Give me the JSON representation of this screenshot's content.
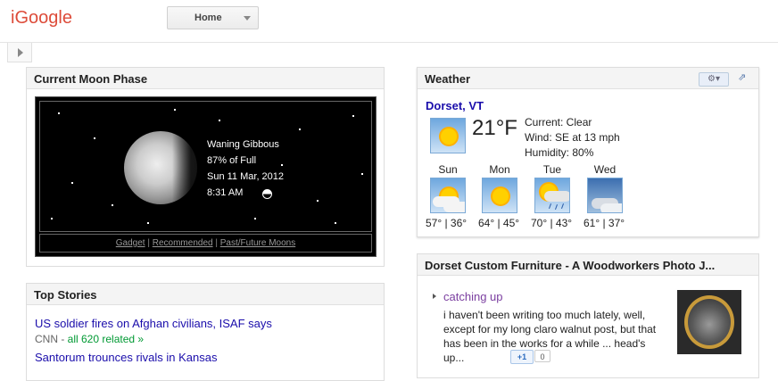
{
  "header": {
    "logo_text": "iGoogle",
    "tab_label": "Home"
  },
  "moon": {
    "title": "Current Moon Phase",
    "phase_name": "Waning Gibbous",
    "percent_full": "87% of Full",
    "date": "Sun 11 Mar, 2012",
    "time": "8:31 AM",
    "links": [
      "Gadget",
      "Recommended",
      "Past/Future Moons"
    ],
    "separator": "|"
  },
  "stories": {
    "title": "Top Stories",
    "items": [
      {
        "headline": "US soldier fires on Afghan civilians, ISAF says",
        "source": "CNN",
        "related": "all 620 related »"
      },
      {
        "headline": "Santorum trounces rivals in Kansas"
      }
    ],
    "source_sep": " - "
  },
  "weather": {
    "title": "Weather",
    "location": "Dorset, VT",
    "current_temp": "21°F",
    "condition": "Current: Clear",
    "wind": "Wind: SE at 13 mph",
    "humidity": "Humidity: 80%",
    "forecast": [
      {
        "day": "Sun",
        "temps": "57° | 36°",
        "icon": "partly-cloudy-icon"
      },
      {
        "day": "Mon",
        "temps": "64° | 45°",
        "icon": "sunny-icon"
      },
      {
        "day": "Tue",
        "temps": "70° | 43°",
        "icon": "sun-rain-icon"
      },
      {
        "day": "Wed",
        "temps": "61° | 37°",
        "icon": "cloudy-icon"
      }
    ],
    "menu_glyph": "⚙▾",
    "expand_glyph": "⇗"
  },
  "furniture": {
    "title": "Dorset Custom Furniture - A Woodworkers Photo J...",
    "post_title": "catching up",
    "post_excerpt": "i haven't been writing too much lately, well, except for my long claro walnut post, but that has been in the works for a while ... head's up...",
    "plus_one_label": "+1",
    "plus_one_count": "0"
  },
  "colors": {
    "logo": "#dd4b39",
    "link": "#1a0dab",
    "visited": "#7b3fa0",
    "related": "#009933"
  }
}
